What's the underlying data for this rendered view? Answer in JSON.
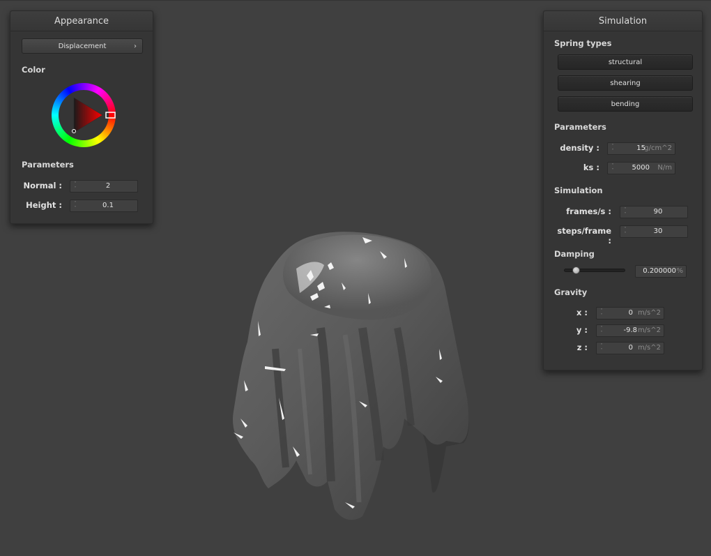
{
  "appearance": {
    "title": "Appearance",
    "shader_combo": "Displacement",
    "color_label": "Color",
    "color_value": "#ff0000",
    "parameters_label": "Parameters",
    "normal_label": "Normal :",
    "normal_value": "2",
    "height_label": "Height :",
    "height_value": "0.1"
  },
  "simulation": {
    "title": "Simulation",
    "spring_types_label": "Spring types",
    "structural_label": "structural",
    "shearing_label": "shearing",
    "bending_label": "bending",
    "parameters_label": "Parameters",
    "density_label": "density :",
    "density_value": "15",
    "density_unit": "g/cm^2",
    "ks_label": "ks :",
    "ks_value": "5000",
    "ks_unit": "N/m",
    "simulation_label": "Simulation",
    "fps_label": "frames/s :",
    "fps_value": "90",
    "steps_label": "steps/frame :",
    "steps_value": "30",
    "damping_label": "Damping",
    "damping_fraction": 0.2,
    "damping_value": "0.200000",
    "damping_unit": "%",
    "gravity_label": "Gravity",
    "gx_label": "x :",
    "gx_value": "0",
    "gy_label": "y :",
    "gy_value": "-9.8",
    "gz_label": "z :",
    "gz_value": "0",
    "gravity_unit": "m/s^2"
  }
}
